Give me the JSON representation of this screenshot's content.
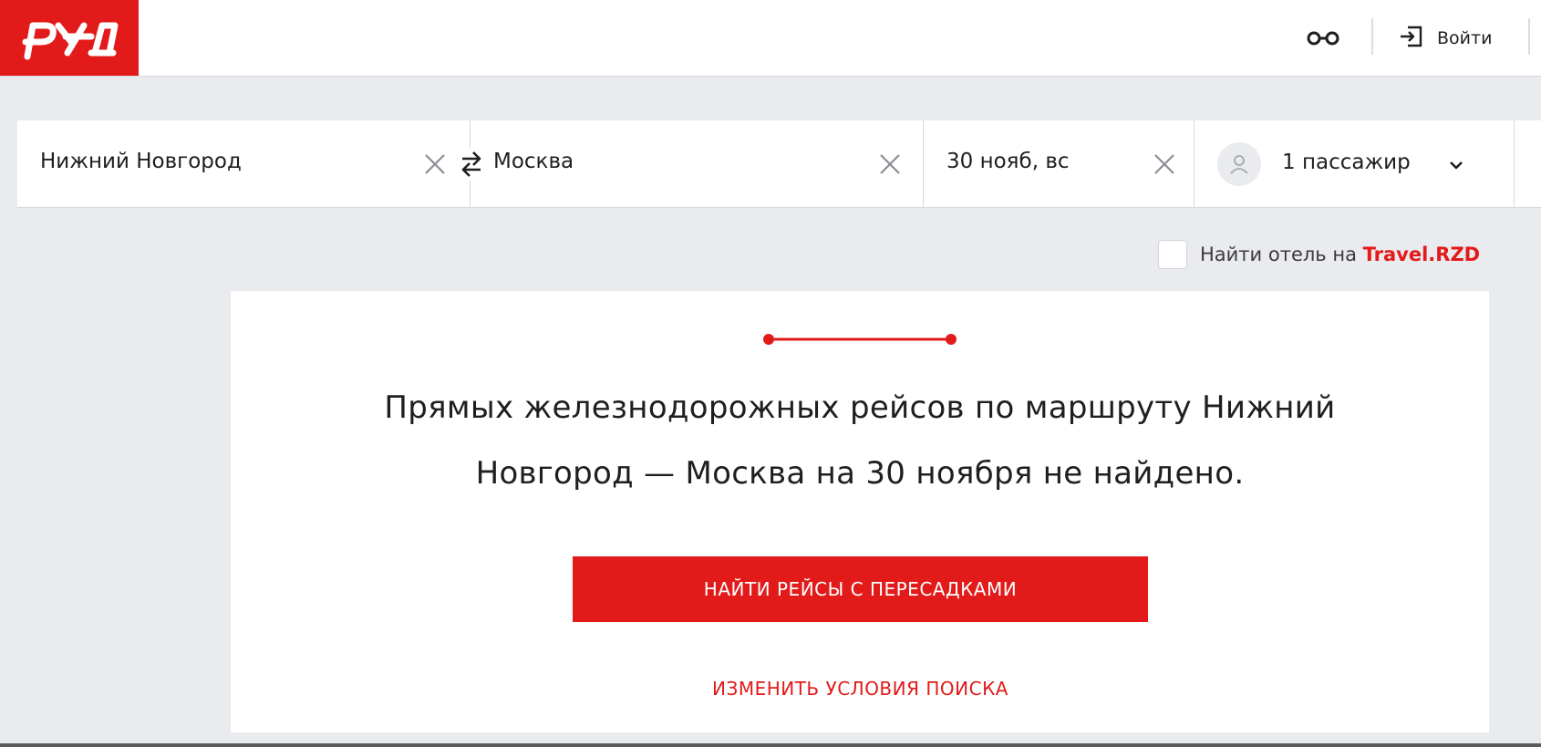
{
  "header": {
    "logo_text": "РЖД",
    "accessibility_icon": "glasses-icon",
    "login_icon": "login-icon",
    "login_label": "Войти"
  },
  "search": {
    "from": "Нижний Новгород",
    "to": "Москва",
    "date": "30 нояб, вс",
    "passengers": "1 пассажир",
    "swap_icon": "swap-arrows-icon",
    "clear_icon": "close-icon",
    "passenger_icon": "user-icon",
    "dropdown_icon": "chevron-down-icon"
  },
  "hotel": {
    "label": "Найти отель на ",
    "link": "Travel.RZD",
    "checked": false
  },
  "result": {
    "message_line1": "Прямых железнодорожных рейсов по маршруту Нижний",
    "message_line2": "Новгород — Москва на 30 ноября не найдено.",
    "primary_button": "НАЙТИ РЕЙСЫ С ПЕРЕСАДКАМИ",
    "secondary_link": "ИЗМЕНИТЬ УСЛОВИЯ ПОИСКА"
  },
  "colors": {
    "brand": "#e21a1a",
    "background": "#e9ebee",
    "surface": "#ffffff",
    "text": "#1f1f1f"
  }
}
